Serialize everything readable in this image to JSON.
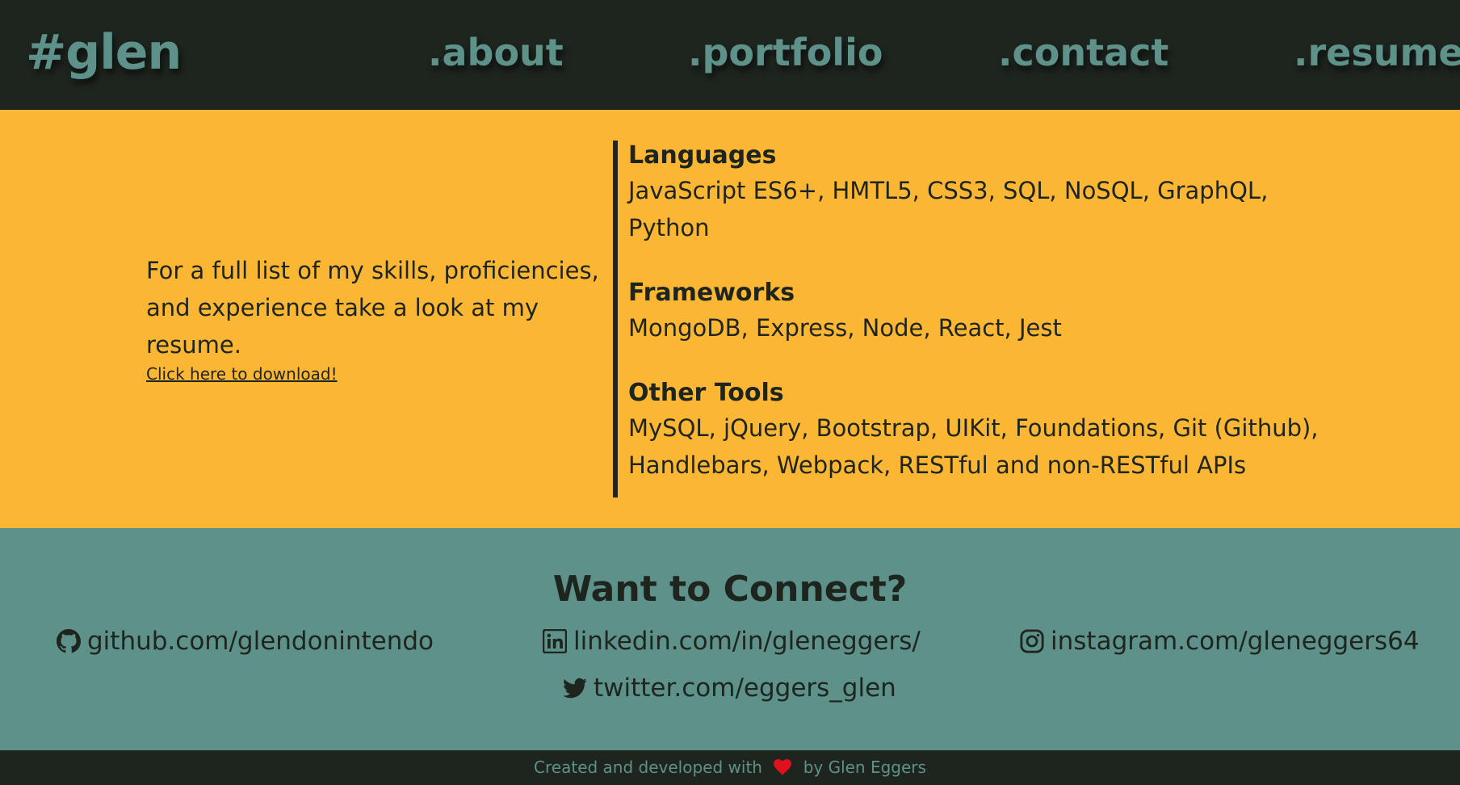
{
  "header": {
    "logo": "#glen",
    "nav": [
      {
        "label": ".about"
      },
      {
        "label": ".portfolio"
      },
      {
        "label": ".contact"
      },
      {
        "label": ".resume"
      }
    ]
  },
  "skills": {
    "intro": "For a full list of my skills, proficiencies, and experience take a look at my resume.",
    "download_link": "Click here to download!",
    "groups": [
      {
        "title": "Languages",
        "items": "JavaScript ES6+, HMTL5, CSS3, SQL, NoSQL, GraphQL, Python"
      },
      {
        "title": "Frameworks",
        "items": "MongoDB, Express, Node, React, Jest"
      },
      {
        "title": "Other Tools",
        "items": "MySQL, jQuery, Bootstrap, UIKit, Foundations, Git (Github), Handlebars, Webpack, RESTful and non-RESTful APIs"
      }
    ]
  },
  "connect": {
    "title": "Want to Connect?",
    "links": [
      {
        "icon": "github-icon",
        "label": "github.com/glendonintendo"
      },
      {
        "icon": "linkedin-icon",
        "label": "linkedin.com/in/gleneggers/"
      },
      {
        "icon": "instagram-icon",
        "label": "instagram.com/gleneggers64"
      },
      {
        "icon": "twitter-icon",
        "label": "twitter.com/eggers_glen"
      }
    ]
  },
  "footer": {
    "prefix": "Created and developed with",
    "suffix": "by Glen Eggers"
  },
  "colors": {
    "dark": "#1e241e",
    "teal": "#5d9189",
    "yellow": "#fbb733",
    "heart": "#e0101c"
  }
}
